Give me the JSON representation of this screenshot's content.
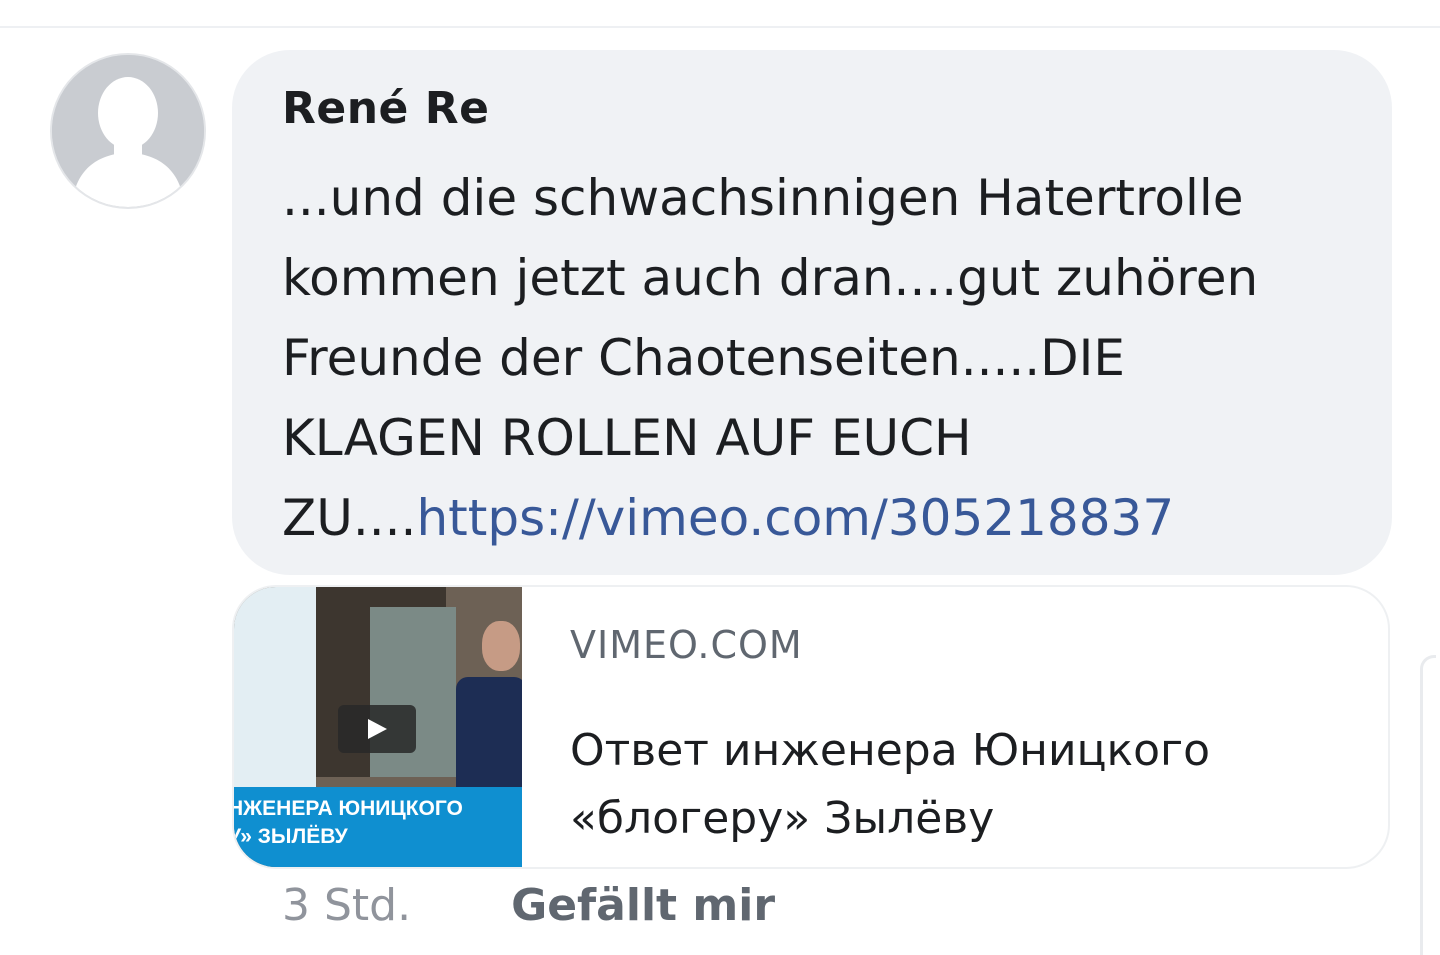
{
  "comment": {
    "author": "René Re",
    "text": "...und die schwachsinnigen Hatertrolle kommen jetzt auch dran....gut zuhören Freunde der Chaotenseiten.....DIE KLAGEN ROLLEN AUF EUCH ZU....",
    "link": "https://vimeo.com/305218837",
    "timestamp": "3 Std.",
    "like_label": "Gefällt mir"
  },
  "link_preview": {
    "domain": "VIMEO.COM",
    "title": "Ответ инженера Юницкого «блогеру» Зылёву",
    "thumbnail_caption_line1": "НЖЕНЕРА ЮНИЦКОГО",
    "thumbnail_caption_line2": "У» ЗЫЛЁВУ"
  },
  "colors": {
    "bubble_bg": "#f0f2f5",
    "link": "#385898",
    "text": "#1c1e21",
    "meta": "#90949c"
  },
  "icons": {
    "avatar": "default-profile-silhouette-icon",
    "play": "play-icon"
  }
}
